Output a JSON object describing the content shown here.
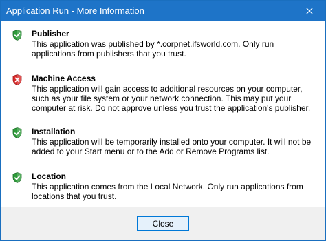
{
  "window": {
    "title": "Application Run - More Information"
  },
  "colors": {
    "titlebar": "#1e74c8",
    "shield_ok": "#2e9b3a",
    "shield_warn": "#d92b2b"
  },
  "sections": [
    {
      "heading": "Publisher",
      "icon": "shield-check-icon",
      "status": "ok",
      "text": "This application was published by *.corpnet.ifsworld.com. Only run applications from publishers that you trust."
    },
    {
      "heading": "Machine Access",
      "icon": "shield-x-icon",
      "status": "warning",
      "text": "This application will gain access to additional resources on your computer, such as your file system or your network connection. This may put your computer at risk. Do not approve unless you trust the application's publisher."
    },
    {
      "heading": "Installation",
      "icon": "shield-check-icon",
      "status": "ok",
      "text": "This application will be temporarily installed onto your computer. It will not be added to your Start menu or to the Add or Remove Programs list."
    },
    {
      "heading": "Location",
      "icon": "shield-check-icon",
      "status": "ok",
      "text": "This application comes from the Local Network. Only run applications from locations that you trust."
    }
  ],
  "footer": {
    "close_label": "Close"
  }
}
